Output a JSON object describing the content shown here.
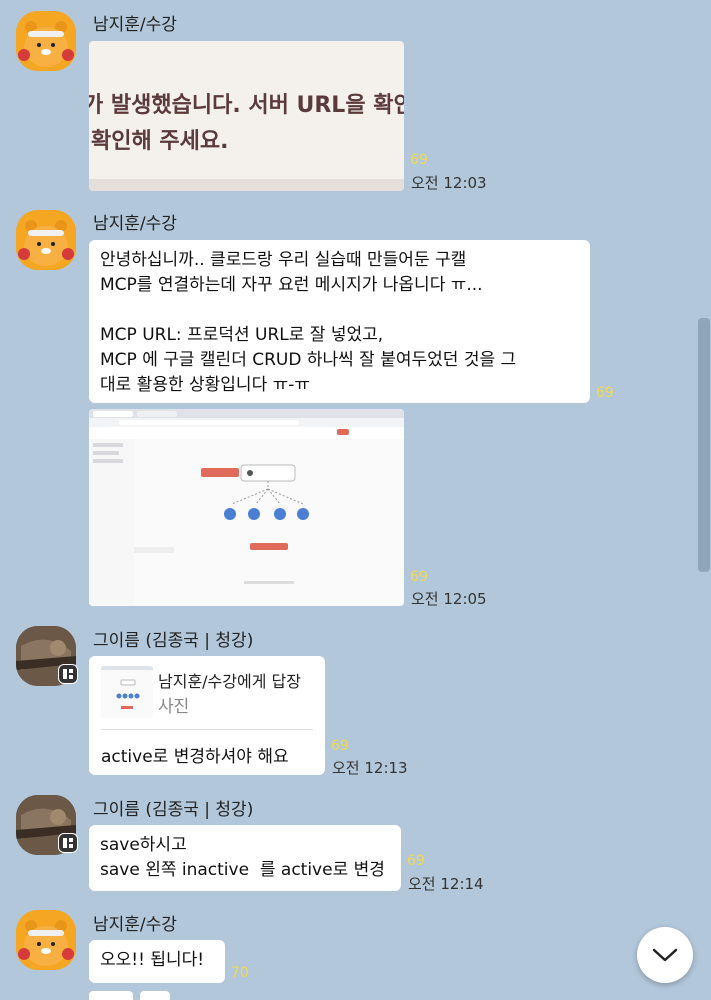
{
  "messages": [
    {
      "sender": "남지훈/수강",
      "image_text": [
        "가 발생했습니다. 서버 URL을 확인",
        "확인해 주세요."
      ],
      "unread": "69",
      "time": "오전 12:03"
    },
    {
      "sender": "남지훈/수강",
      "text": "안녕하십니까.. 클로드랑 우리 실습때 만들어둔 구캘\nMCP를 연결하는데 자꾸 요런 메시지가 나옵니다 ㅠ...\n\nMCP URL: 프로덕션 URL로 잘 넣었고,\nMCP 에 구글 캘린더 CRUD 하나씩 잘 붙여두었던 것을 그\n대로 활용한 상황입니다 ㅠ-ㅠ",
      "unread": "69",
      "screenshot_unread": "69",
      "time": "오전 12:05"
    },
    {
      "sender": "그이름 (김종국 | 청강)",
      "reply_to": "남지훈/수강에게 답장",
      "reply_type": "사진",
      "text": "active로 변경하셔야 해요",
      "unread": "69",
      "time": "오전 12:13"
    },
    {
      "sender": "그이름 (김종국 | 청강)",
      "text": "save하시고\nsave 왼쪽 inactive  를 active로 변경",
      "unread": "69",
      "time": "오전 12:14"
    },
    {
      "sender": "남지훈/수강",
      "text": "오오!! 됩니다!",
      "unread": "70"
    }
  ],
  "icons": {
    "scroll_down": "chevron-down-icon",
    "admin_badge": "admin-badge-icon"
  }
}
